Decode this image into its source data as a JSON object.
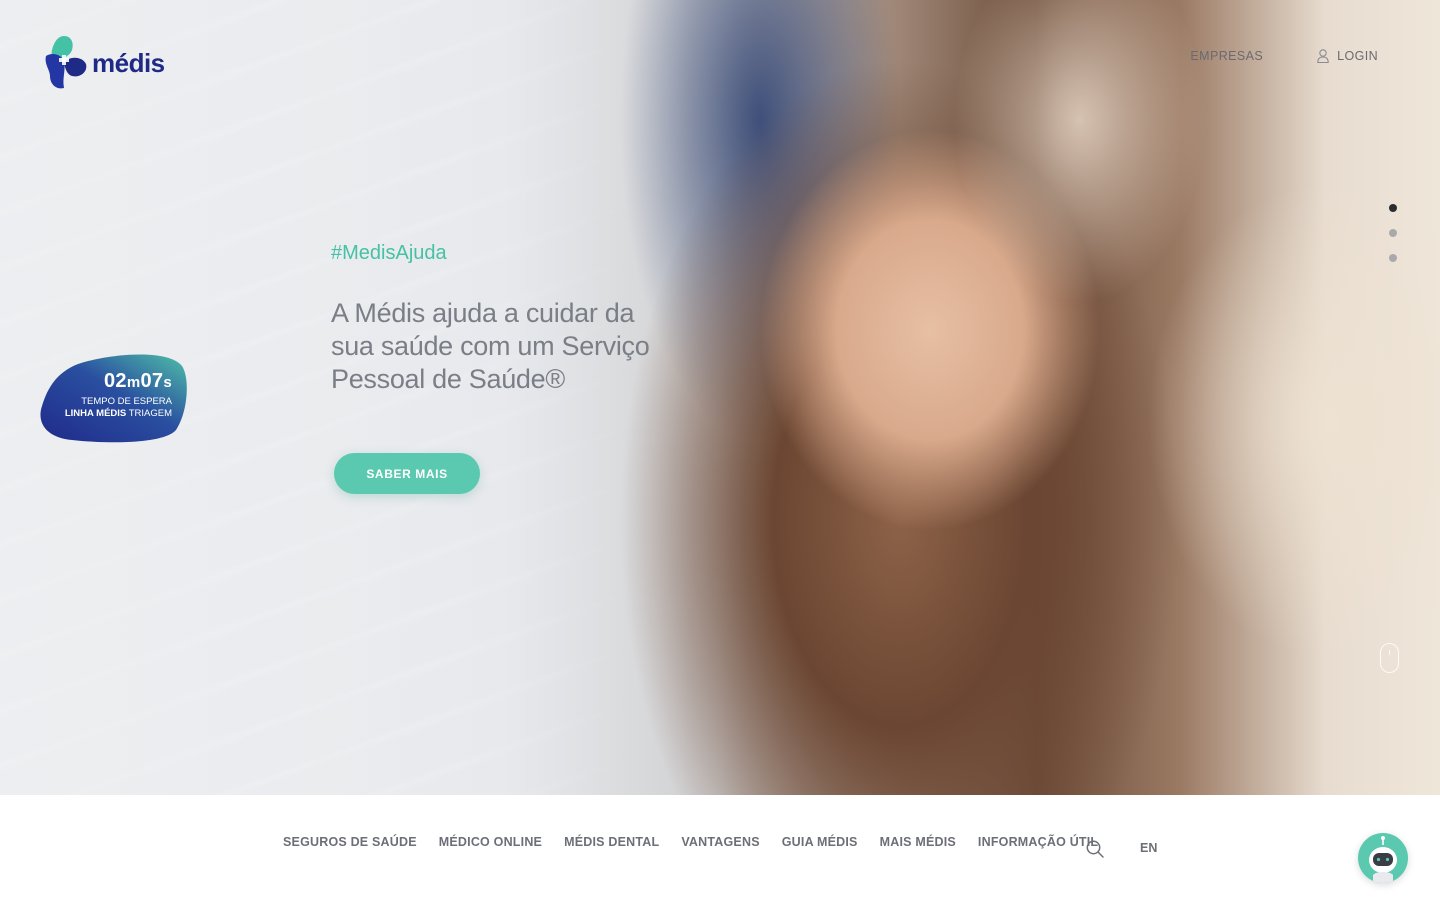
{
  "brand": {
    "name": "médis"
  },
  "topnav": {
    "empresas": "EMPRESAS",
    "login": "LOGIN"
  },
  "hero": {
    "hashtag": "#MedisAjuda",
    "headline_1": "A Médis ajuda a cuidar da",
    "headline_2": "sua saúde com um Serviço",
    "headline_3": "Pessoal de Saúde®",
    "cta": "SABER MAIS"
  },
  "wait": {
    "minutes": "02",
    "m_unit": "m",
    "seconds": "07",
    "s_unit": "s",
    "label_1": "TEMPO DE ESPERA",
    "label_2_bold": "LINHA MÉDIS",
    "label_2_rest": " TRIAGEM"
  },
  "slider": {
    "count": 3,
    "active": 1
  },
  "menu": {
    "items": [
      "SEGUROS DE SAÚDE",
      "MÉDICO ONLINE",
      "MÉDIS DENTAL",
      "VANTAGENS",
      "GUIA MÉDIS",
      "MAIS MÉDIS",
      "INFORMAÇÃO ÚTIL"
    ],
    "lang": "EN"
  },
  "icons": {
    "login": "user-icon",
    "search": "search-icon",
    "scroll": "mouse-scroll-icon",
    "chat": "chatbot-robot-icon"
  },
  "colors": {
    "brand_blue": "#1f2a86",
    "accent_green": "#5ac9b0",
    "hashtag_green": "#45c1a5"
  }
}
